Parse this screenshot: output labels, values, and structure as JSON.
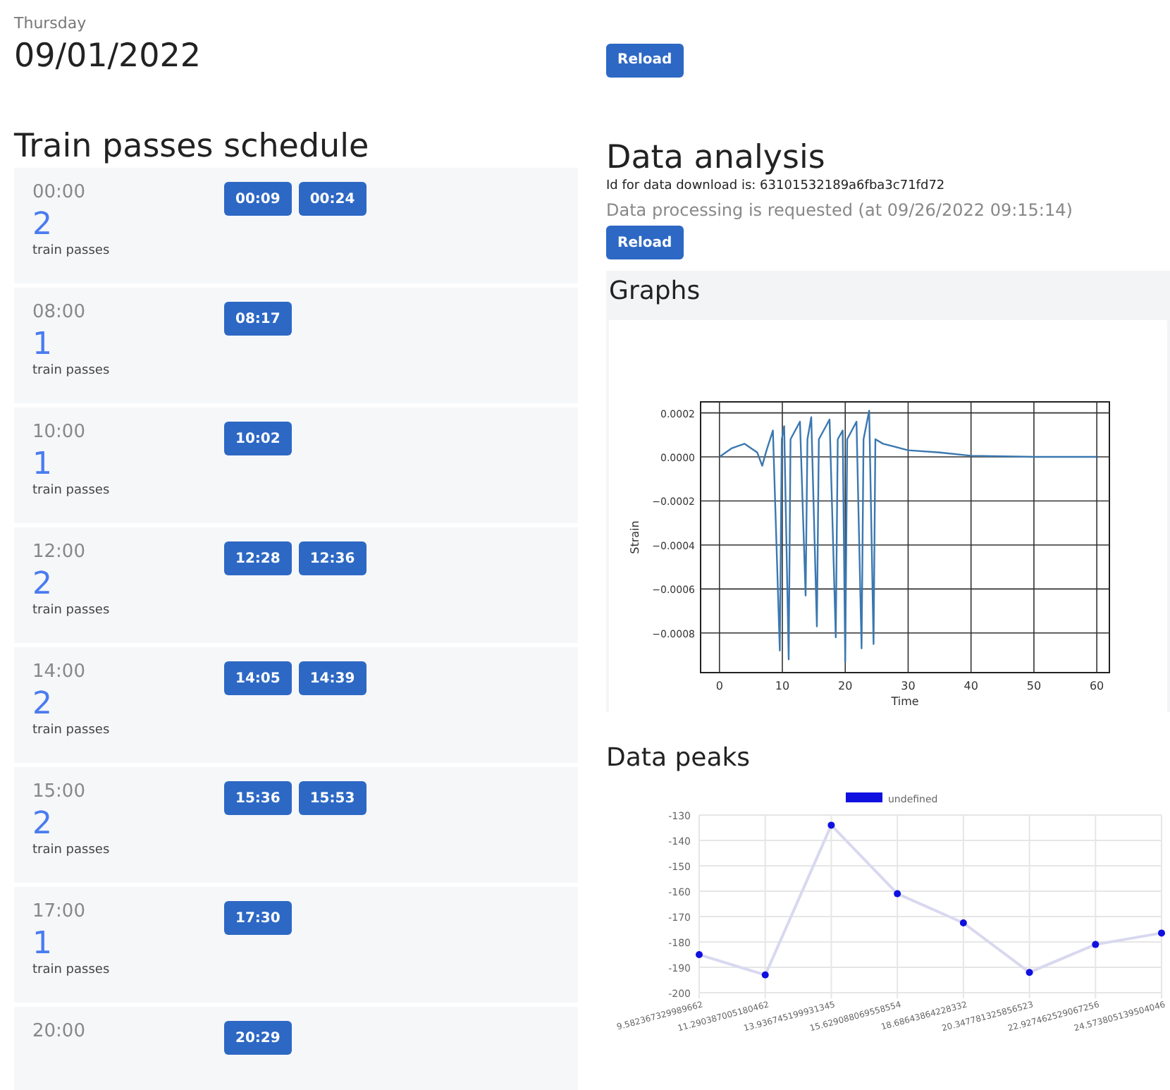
{
  "date": {
    "weekday": "Thursday",
    "value": "09/01/2022"
  },
  "top_reload": "Reload",
  "schedule": {
    "title": "Train passes schedule",
    "rows": [
      {
        "hour": "00:00",
        "count": "2",
        "unit": "train passes",
        "passes": [
          "00:09",
          "00:24"
        ]
      },
      {
        "hour": "08:00",
        "count": "1",
        "unit": "train passes",
        "passes": [
          "08:17"
        ]
      },
      {
        "hour": "10:00",
        "count": "1",
        "unit": "train passes",
        "passes": [
          "10:02"
        ]
      },
      {
        "hour": "12:00",
        "count": "2",
        "unit": "train passes",
        "passes": [
          "12:28",
          "12:36"
        ]
      },
      {
        "hour": "14:00",
        "count": "2",
        "unit": "train passes",
        "passes": [
          "14:05",
          "14:39"
        ]
      },
      {
        "hour": "15:00",
        "count": "2",
        "unit": "train passes",
        "passes": [
          "15:36",
          "15:53"
        ]
      },
      {
        "hour": "17:00",
        "count": "1",
        "unit": "train passes",
        "passes": [
          "17:30"
        ]
      },
      {
        "hour": "20:00",
        "passes": [
          "20:29"
        ]
      }
    ]
  },
  "analysis": {
    "title": "Data analysis",
    "id_text": "Id for data download is: 63101532189a6fba3c71fd72",
    "status": "Data processing is requested (at 09/26/2022 09:15:14)",
    "reload": "Reload",
    "graphs": {
      "title": "Graphs",
      "chart_data": {
        "type": "line",
        "grid": true,
        "xlabel": "Time",
        "x": [
          0,
          2,
          4,
          6,
          6.8,
          7.5,
          8.5,
          9.6,
          9.9,
          10.3,
          11,
          11.3,
          12.8,
          13.7,
          14,
          14.6,
          15.5,
          15.8,
          17.5,
          18.5,
          18.8,
          19.6,
          20,
          20.3,
          21.8,
          22.6,
          22.9,
          23.8,
          24.5,
          24.8,
          26,
          30,
          35,
          40,
          50,
          60
        ],
        "series": [
          {
            "color": "#3b78b0",
            "values": [
              0,
              4e-05,
              6e-05,
              2e-05,
              -4e-05,
              3e-05,
              0.00012,
              -0.00088,
              8e-05,
              0.00014,
              -0.00092,
              8e-05,
              0.00016,
              -0.00063,
              8e-05,
              0.00018,
              -0.00077,
              8e-05,
              0.00017,
              -0.00082,
              8e-05,
              0.00012,
              -0.00093,
              8e-05,
              0.00016,
              -0.00087,
              8e-05,
              0.00021,
              -0.00085,
              8e-05,
              6e-05,
              3e-05,
              2e-05,
              5e-06,
              0,
              0
            ]
          }
        ],
        "ylabel": "Strain",
        "xlim": [
          -3,
          62
        ],
        "ylim": [
          -0.00098,
          0.00025
        ],
        "xticks": [
          0,
          10,
          20,
          30,
          40,
          50,
          60
        ],
        "yticks": [
          {
            "value": 0.0002,
            "label": "0.0002"
          },
          {
            "value": 0,
            "label": "0.0000"
          },
          {
            "value": -0.0002,
            "label": "−0.0002"
          },
          {
            "value": -0.0004,
            "label": "−0.0004"
          },
          {
            "value": -0.0006,
            "label": "−0.0006"
          },
          {
            "value": -0.0008,
            "label": "−0.0008"
          }
        ]
      }
    },
    "peaks": {
      "title": "Data peaks",
      "chart_data": {
        "type": "line",
        "grid": true,
        "categories": [
          "9.582367329989662",
          "11.290387005180462",
          "13.936745199931345",
          "15.629088069558554",
          "18.68643864228332",
          "20.347781325856523",
          "22.927462529067256",
          "24.573805139504046"
        ],
        "series": [
          {
            "name": "undefined",
            "color": "#1010e0",
            "marker": true,
            "values": [
              -185,
              -193,
              -134,
              -161,
              -172.5,
              -192,
              -181,
              -176.5
            ]
          }
        ],
        "ylim": [
          -200,
          -130
        ],
        "yticks": [
          -130,
          -140,
          -150,
          -160,
          -170,
          -180,
          -190,
          -200
        ]
      }
    }
  }
}
